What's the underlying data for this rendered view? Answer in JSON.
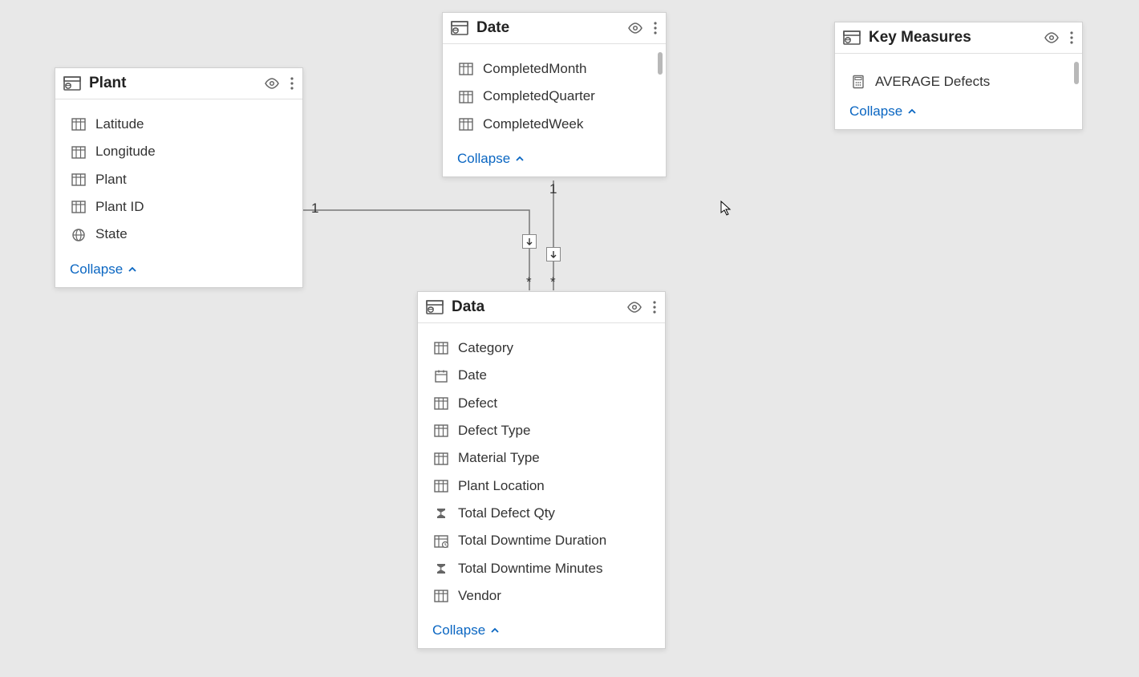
{
  "collapse_label": "Collapse",
  "tables": {
    "plant": {
      "title": "Plant",
      "fields": [
        {
          "icon": "column",
          "label": "Latitude"
        },
        {
          "icon": "column",
          "label": "Longitude"
        },
        {
          "icon": "column",
          "label": "Plant"
        },
        {
          "icon": "column",
          "label": "Plant ID"
        },
        {
          "icon": "globe",
          "label": "State"
        }
      ]
    },
    "date": {
      "title": "Date",
      "fields": [
        {
          "icon": "column",
          "label": "CompletedMonth"
        },
        {
          "icon": "column",
          "label": "CompletedQuarter"
        },
        {
          "icon": "column",
          "label": "CompletedWeek"
        }
      ]
    },
    "data": {
      "title": "Data",
      "fields": [
        {
          "icon": "column",
          "label": "Category"
        },
        {
          "icon": "calendar",
          "label": "Date"
        },
        {
          "icon": "column",
          "label": "Defect"
        },
        {
          "icon": "column",
          "label": "Defect Type"
        },
        {
          "icon": "column",
          "label": "Material Type"
        },
        {
          "icon": "column",
          "label": "Plant Location"
        },
        {
          "icon": "sigma",
          "label": "Total Defect Qty"
        },
        {
          "icon": "measure",
          "label": "Total Downtime Duration"
        },
        {
          "icon": "sigma",
          "label": "Total Downtime Minutes"
        },
        {
          "icon": "column",
          "label": "Vendor"
        }
      ]
    },
    "keymeasures": {
      "title": "Key Measures",
      "fields": [
        {
          "icon": "calc",
          "label": "AVERAGE Defects"
        }
      ]
    }
  },
  "relationships": {
    "plant_to_data": {
      "from_card": "1",
      "to_card": "*"
    },
    "date_to_data": {
      "from_card": "1",
      "to_card": "*"
    }
  }
}
